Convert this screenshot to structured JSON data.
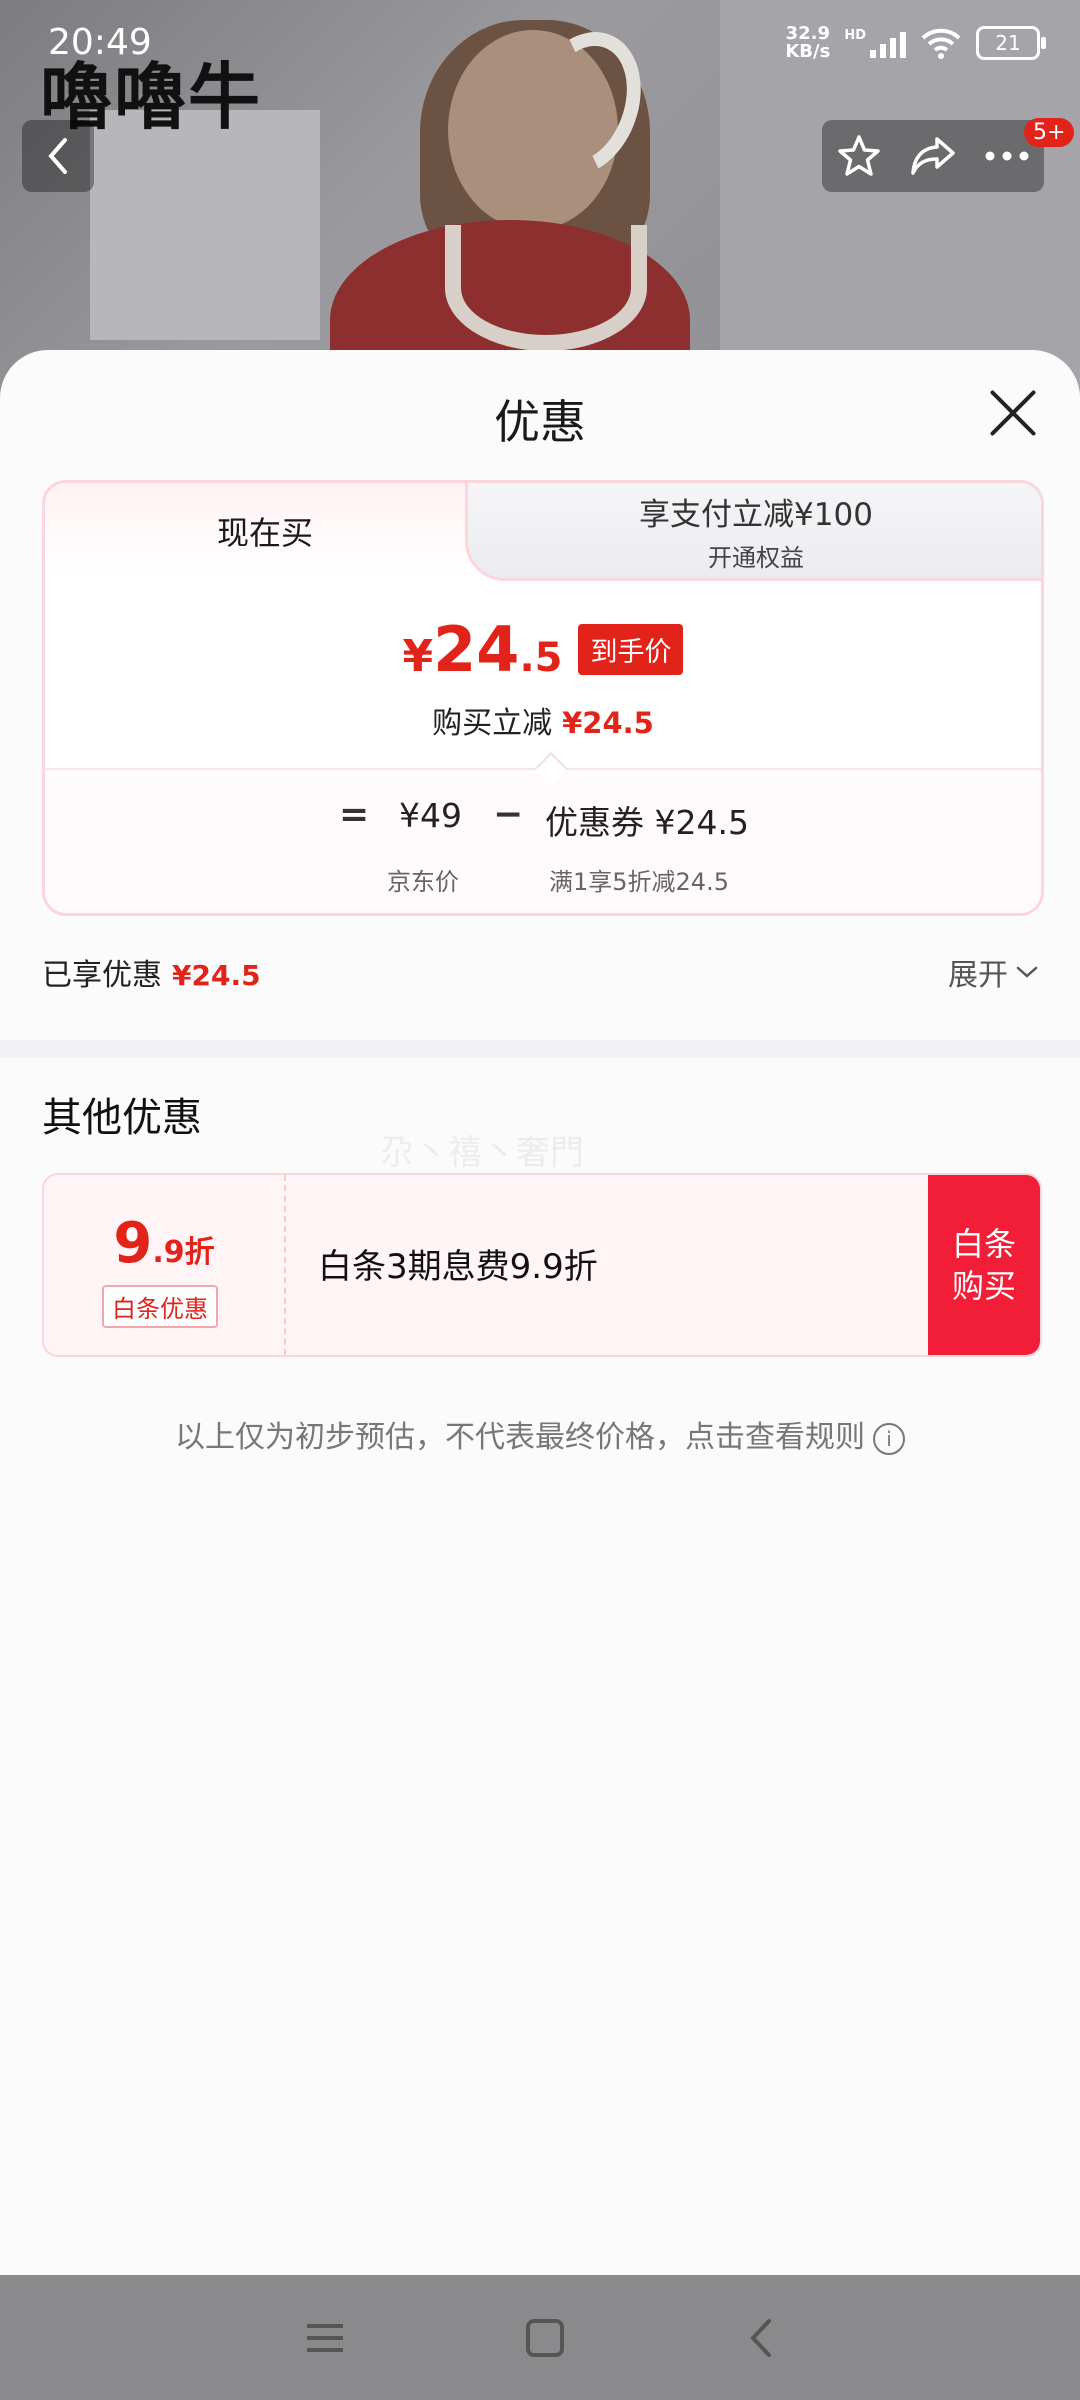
{
  "status_bar": {
    "time": "20:49",
    "net_speed_value": "32.9",
    "net_speed_unit": "KB/s",
    "signal_label": "HD",
    "battery": "21"
  },
  "watermark": "嚕嚕牛",
  "top_nav": {
    "back_icon": "chevron-left-icon",
    "favorite_icon": "star-icon",
    "share_icon": "share-icon",
    "more_icon": "more-icon",
    "more_badge": "5+"
  },
  "sheet": {
    "title": "优惠",
    "tabs": {
      "now_label": "现在买",
      "pay_label": "享支付立减¥100",
      "pay_sub": "开通权益"
    },
    "final": {
      "currency": "¥",
      "integer": "24",
      "decimal": ".5",
      "tag": "到手价",
      "reduce_label": "购买立减",
      "reduce_amount": "¥24.5"
    },
    "breakdown": {
      "equals": "=",
      "price": "¥49",
      "price_label": "京东价",
      "minus": "−",
      "coupon": "优惠券 ¥24.5",
      "coupon_label": "满1享5折减24.5"
    },
    "enjoyed_label": "已享优惠",
    "enjoyed_amount": "¥24.5",
    "expand_label": "展开",
    "other_title": "其他优惠",
    "faint_text": "尕丶禧丶奢門",
    "coupon": {
      "big": "9",
      "small": ".9折",
      "tag": "白条优惠",
      "desc": "白条3期息费9.9折",
      "button_line1": "白条",
      "button_line2": "购买"
    },
    "note": "以上仅为初步预估，不代表最终价格，点击查看规则"
  },
  "colors": {
    "accent_red": "#e2231a",
    "button_red": "#f21d36",
    "sheet_bg": "#fbfbfb"
  }
}
